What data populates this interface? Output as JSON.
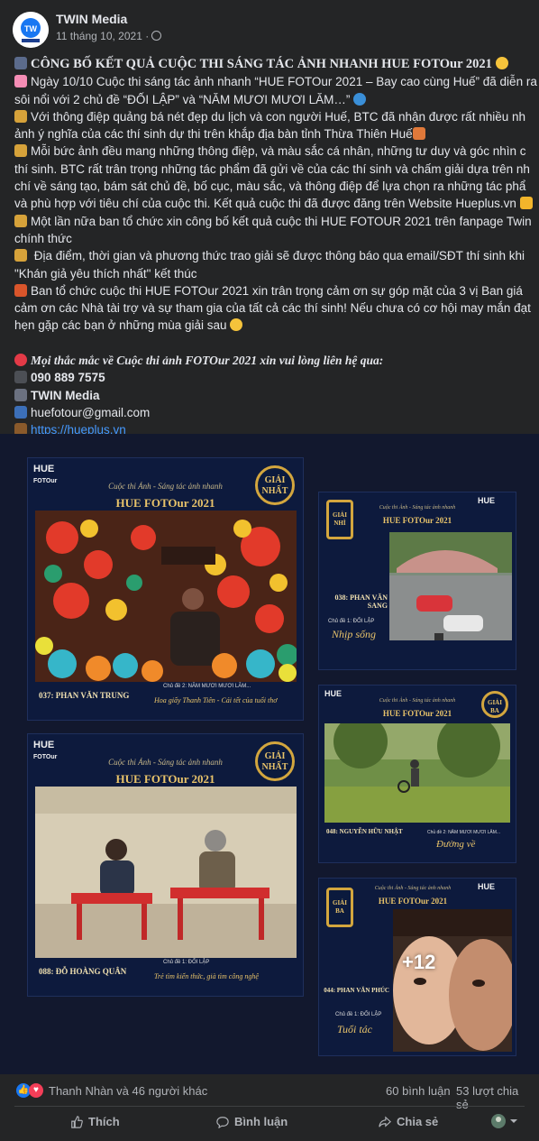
{
  "post": {
    "author": "TWIN Media",
    "date": "11 tháng 10, 2021 ·",
    "lines": [
      "CÔNG BỐ KẾT QUẢ CUỘC THI SÁNG TÁC ẢNH NHANH  HUE FOTOur 2021",
      "Ngày 10/10 Cuộc thi sáng tác ảnh nhanh “HUE FOTOur 2021 – Bay cao cùng Huế” đã diễn ra",
      "sôi nổi với 2 chủ đề “ĐỐI LẬP” và “NĂM MƯƠI MƯƠI LĂM…”",
      "Với thông điệp quảng bá nét đẹp du lịch và con người Huế, BTC đã nhận được rất nhiều nh",
      "ảnh ý nghĩa của các thí sinh dự thi trên khắp địa bàn tỉnh Thừa Thiên Huế",
      "Mỗi bức ảnh đều mang những thông điệp, và màu sắc cá nhân, những tư duy và góc nhìn c",
      "thí sinh. BTC rất trân trọng những tác phẩm đã gửi về của các thí sinh và chấm giải dựa trên nh",
      "chí về sáng tạo, bám sát chủ đề, bố cục, màu sắc, và thông điệp để lựa chọn ra những tác phẩ",
      "và phù hợp với tiêu chí của cuộc thi. Kết quả cuộc thi đã được đăng trên Website Hueplus.vn",
      "Một lần nữa ban tổ chức xin công bố kết quả cuộc thi HUE FOTOUR 2021 trên fanpage Twin",
      "chính thức",
      " Địa điểm, thời gian và phương thức trao giải sẽ được thông báo qua email/SĐT thí sinh khi",
      "\"Khán giả yêu thích nhất\" kết thúc",
      "Ban tổ chức cuộc thi HUE FOTOur 2021 xin trân trọng cảm ơn sự góp mặt của 3 vị Ban giá",
      "cảm ơn các Nhà tài trợ và sự tham gia của tất cả các thí sinh! Nếu chưa có cơ hội may mắn đạt",
      "hẹn gặp các bạn ở những mùa giải sau",
      "",
      "Mọi thắc mắc về Cuộc thi ảnh FOTOur 2021 xin vui lòng liên hệ qua:",
      "090 889 7575",
      "TWIN Media",
      "huefotour@gmail.com",
      "https://hueplus.vn",
      "...."
    ]
  },
  "gallery": {
    "logo": "HUE",
    "logo_sub": "FOTOur",
    "slogan": "Cuộc thi Ảnh - Sáng tác ảnh nhanh",
    "contest": "HUE FOTOur 2021",
    "cards": [
      {
        "badge": "GIẢI NHẤT",
        "theme": "Chủ đề 2: NĂM MƯƠI MƯƠI LĂM...",
        "name": "037: PHAN VĂN TRUNG",
        "motto": "Hoa giấy Thanh Tiên - Cái tết của tuổi thơ"
      },
      {
        "badge": "GIẢI NHÌ",
        "theme": "Chủ đề 1: ĐỐI LẬP",
        "name": "038: PHAN VĂN SANG",
        "motto": "Nhịp sống"
      },
      {
        "badge": "GIẢI NHẤT",
        "theme": "Chủ đề 1: ĐỐI LẬP",
        "name": "088: ĐỖ HOÀNG QUÂN",
        "motto": "Trẻ tìm kiến thức, già tìm công nghệ"
      },
      {
        "badge": "GIẢI BA",
        "theme": "Chủ đề 2: NĂM MƯƠI MƯƠI LĂM...",
        "name": "048: NGUYỄN HỮU NHẬT",
        "motto": "Đường về"
      },
      {
        "badge": "GIẢI BA",
        "theme": "Chủ đề 1: ĐỐI LẬP",
        "name": "044: PHAN VĂN PHÚC",
        "motto": "Tuổi tác"
      }
    ],
    "more_count": "+12"
  },
  "reactions": {
    "summary": "Thanh Nhàn và 46 người khác",
    "comments": "60 bình luận",
    "shares": "53 lượt chia sẻ"
  },
  "actions": {
    "like": "Thích",
    "comment": "Bình luận",
    "share": "Chia sẻ"
  },
  "colors": {
    "background": "#242526",
    "text": "#e4e6eb",
    "secondary": "#b0b3b8",
    "link": "#4599ff",
    "gold": "#d3a63e",
    "navy": "#0d1a3d"
  }
}
